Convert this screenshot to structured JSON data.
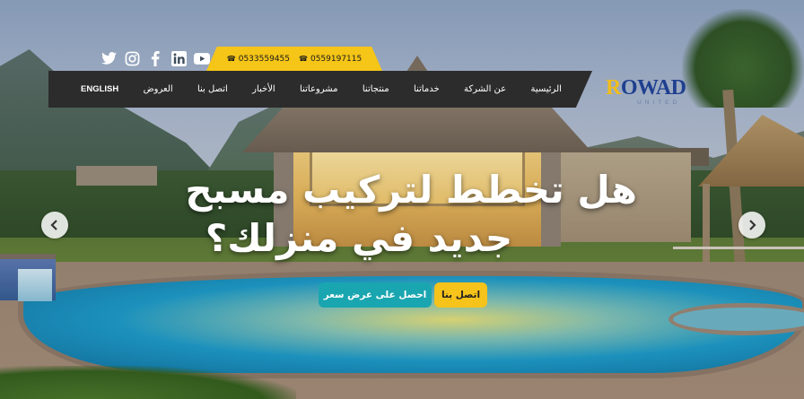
{
  "social": {
    "icons": [
      "twitter-icon",
      "instagram-icon",
      "facebook-icon",
      "linkedin-icon",
      "youtube-icon"
    ]
  },
  "contact": {
    "phone_1": "0533559455",
    "phone_2": "0559197115"
  },
  "nav": {
    "items": [
      "الرئيسية",
      "عن الشركة",
      "خدماتنا",
      "منتجاتنا",
      "مشروعاتنا",
      "الأخبار",
      "اتصل بنا",
      "العروض",
      "ENGLISH"
    ]
  },
  "logo": {
    "main": "OWAD",
    "initial": "R",
    "sub": "UNITED"
  },
  "hero": {
    "headline_line1": "هل تخطط لتركيب مسبح",
    "headline_line2": "جديد في منزلك؟",
    "cta_contact": "اتصل بنا",
    "cta_quote": "احصل على عرض سعر"
  },
  "colors": {
    "accent_yellow": "#f5c517",
    "accent_teal": "#1aa6b0",
    "navbar": "#2c2c2c",
    "logo_blue": "#1f3f8f"
  }
}
